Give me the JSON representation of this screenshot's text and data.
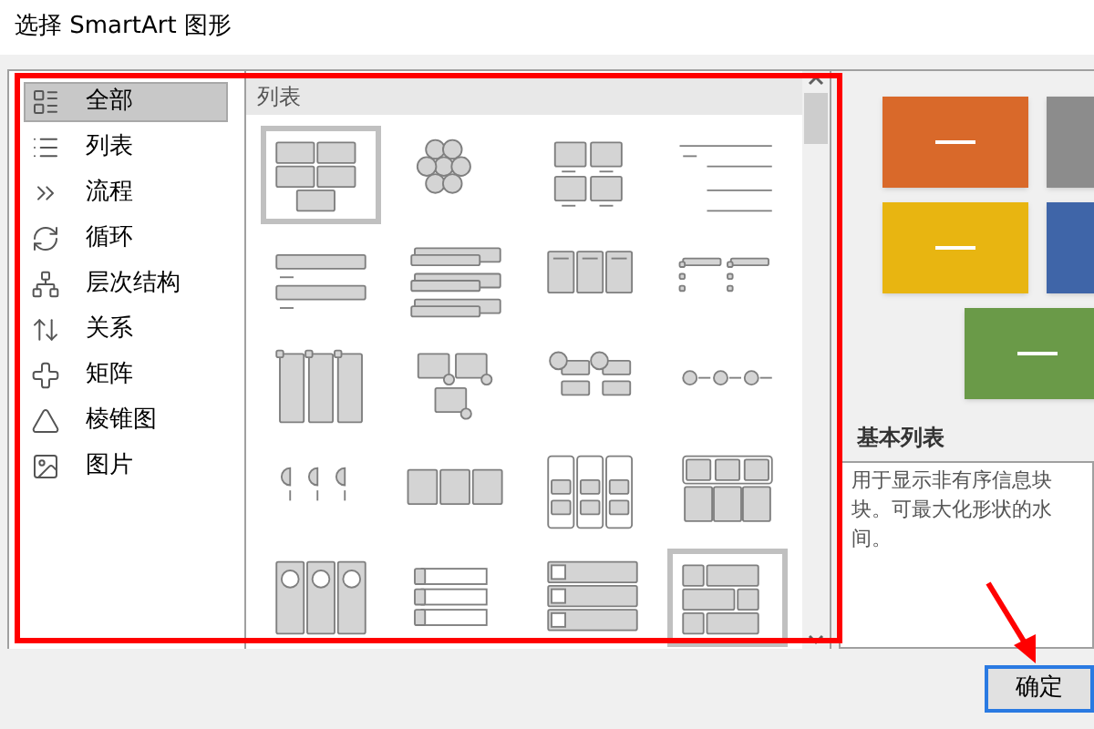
{
  "window": {
    "title": "选择 SmartArt 图形"
  },
  "categories": [
    {
      "label": "全部",
      "kind": "all",
      "selected": true
    },
    {
      "label": "列表",
      "kind": "list",
      "selected": false
    },
    {
      "label": "流程",
      "kind": "process",
      "selected": false
    },
    {
      "label": "循环",
      "kind": "cycle",
      "selected": false
    },
    {
      "label": "层次结构",
      "kind": "hierarchy",
      "selected": false
    },
    {
      "label": "关系",
      "kind": "relationship",
      "selected": false
    },
    {
      "label": "矩阵",
      "kind": "matrix",
      "selected": false
    },
    {
      "label": "棱锥图",
      "kind": "pyramid",
      "selected": false
    },
    {
      "label": "图片",
      "kind": "picture",
      "selected": false
    }
  ],
  "gallery": {
    "heading": "列表",
    "items": [
      {
        "kind": "grid5",
        "selected": true
      },
      {
        "kind": "hexagons",
        "selected": false
      },
      {
        "kind": "grid4",
        "selected": false
      },
      {
        "kind": "lines",
        "selected": false
      },
      {
        "kind": "bars",
        "selected": false
      },
      {
        "kind": "stacked",
        "selected": false
      },
      {
        "kind": "cards",
        "selected": false
      },
      {
        "kind": "checklist",
        "selected": false
      },
      {
        "kind": "columns",
        "selected": false
      },
      {
        "kind": "boxcircles",
        "selected": false
      },
      {
        "kind": "circleboxes",
        "selected": false
      },
      {
        "kind": "circleline",
        "selected": false
      },
      {
        "kind": "pies",
        "selected": false
      },
      {
        "kind": "arrows",
        "selected": false
      },
      {
        "kind": "nested",
        "selected": false
      },
      {
        "kind": "table",
        "selected": false
      },
      {
        "kind": "circlecols",
        "selected": false
      },
      {
        "kind": "tabs",
        "selected": false
      },
      {
        "kind": "pictures",
        "selected": false
      },
      {
        "kind": "brick",
        "selected": true
      }
    ]
  },
  "preview": {
    "blocks": [
      {
        "color": "#d9692a"
      },
      {
        "color": "#8c8c8c"
      },
      {
        "color": "#e8b511"
      },
      {
        "color": "#3f65a8"
      },
      {
        "color": "#6a9a48"
      }
    ],
    "title": "基本列表",
    "description": [
      "用于显示非有序信息块",
      "块。可最大化形状的水",
      "间。"
    ]
  },
  "buttons": [
    {
      "label": "确定"
    }
  ]
}
